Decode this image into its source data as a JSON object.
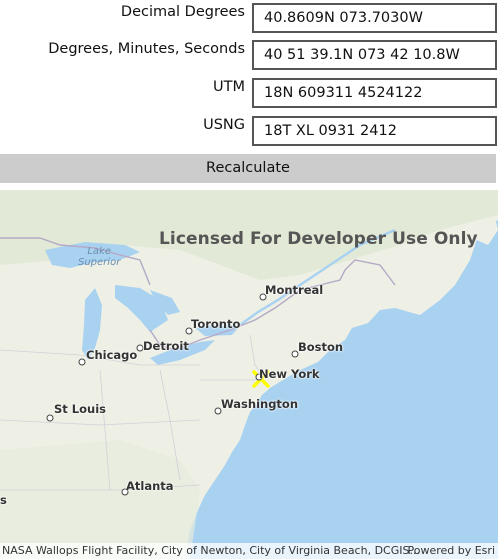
{
  "form": {
    "rows": [
      {
        "label": "Decimal Degrees",
        "value": "40.8609N 073.7030W"
      },
      {
        "label": "Degrees, Minutes, Seconds",
        "value": "40 51 39.1N 073 42 10.8W"
      },
      {
        "label": "UTM",
        "value": "18N 609311 4524122"
      },
      {
        "label": "USNG",
        "value": "18T XL 0931 2412"
      }
    ],
    "recalculate_label": "Recalculate"
  },
  "map": {
    "watermark": "Licensed For Developer Use Only",
    "lakes": {
      "superior_line1": "Lake",
      "superior_line2": "Superior"
    },
    "cities": {
      "montreal": "Montreal",
      "toronto": "Toronto",
      "detroit": "Detroit",
      "chicago": "Chicago",
      "boston": "Boston",
      "new_york": "New York",
      "washington": "Washington",
      "st_louis": "St Louis",
      "atlanta": "Atlanta",
      "edge_fragment": "s"
    },
    "marker_icon": "x-marker-icon",
    "marker_color": "#ffff00",
    "water_color": "#a9d2f1",
    "land_color": "#eef0e6",
    "attribution": "NASA Wallops Flight Facility, City of Newton, City of Virginia Beach, DCGIS...",
    "powered_by": "Powered by Esri"
  }
}
